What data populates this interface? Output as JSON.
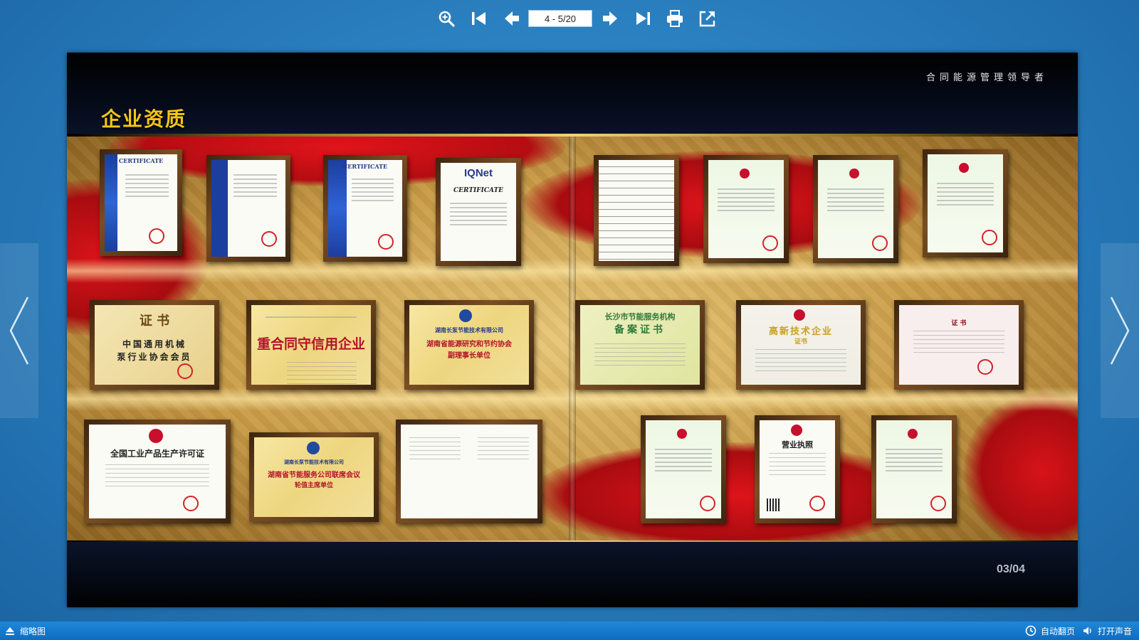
{
  "toolbar": {
    "page_indicator": "4 - 5/20",
    "icons": [
      "zoom-in-icon",
      "first-page-icon",
      "prev-page-icon",
      "next-page-icon",
      "last-page-icon",
      "print-icon",
      "share-icon"
    ]
  },
  "book": {
    "slogan": "合同能源管理领导者",
    "section_title": "企业资质",
    "page_number": "03/04"
  },
  "certificates": {
    "cert_a": {
      "title": "CERTIFICATE"
    },
    "cert_b": {
      "title": "CERTIFICATE"
    },
    "iqnet": {
      "logo": "IQNet",
      "title": "CERTIFICATE"
    },
    "pump_member": {
      "line1": "证 书",
      "line2": "中国通用机械",
      "line3": "泵行业协会会员"
    },
    "credit": {
      "line1": "重合同守信用企业"
    },
    "research": {
      "line1": "湖南长泵节能技术有限公司",
      "line2": "湖南省能源研究和节约协会",
      "line3": "副理事长单位"
    },
    "filing": {
      "line1": "长沙市节能服务机构",
      "line2": "备案证书"
    },
    "hitech": {
      "line1": "高新技术企业",
      "line2": "证书"
    },
    "pink": {
      "line1": "证 书"
    },
    "license": {
      "line1": "全国工业产品生产许可证"
    },
    "esco": {
      "line1": "湖南长泵节能技术有限公司",
      "line2": "湖南省节能服务公司联席会议",
      "line3": "轮值主席单位"
    },
    "business": {
      "line1": "营业执照"
    }
  },
  "statusbar": {
    "thumbnail": "缩略图",
    "auto_flip": "自动翻页",
    "sound": "打开声音"
  },
  "colors": {
    "background": "#2a7fbf",
    "title_gold": "#f5c518",
    "statusbar": "#1478c8"
  }
}
